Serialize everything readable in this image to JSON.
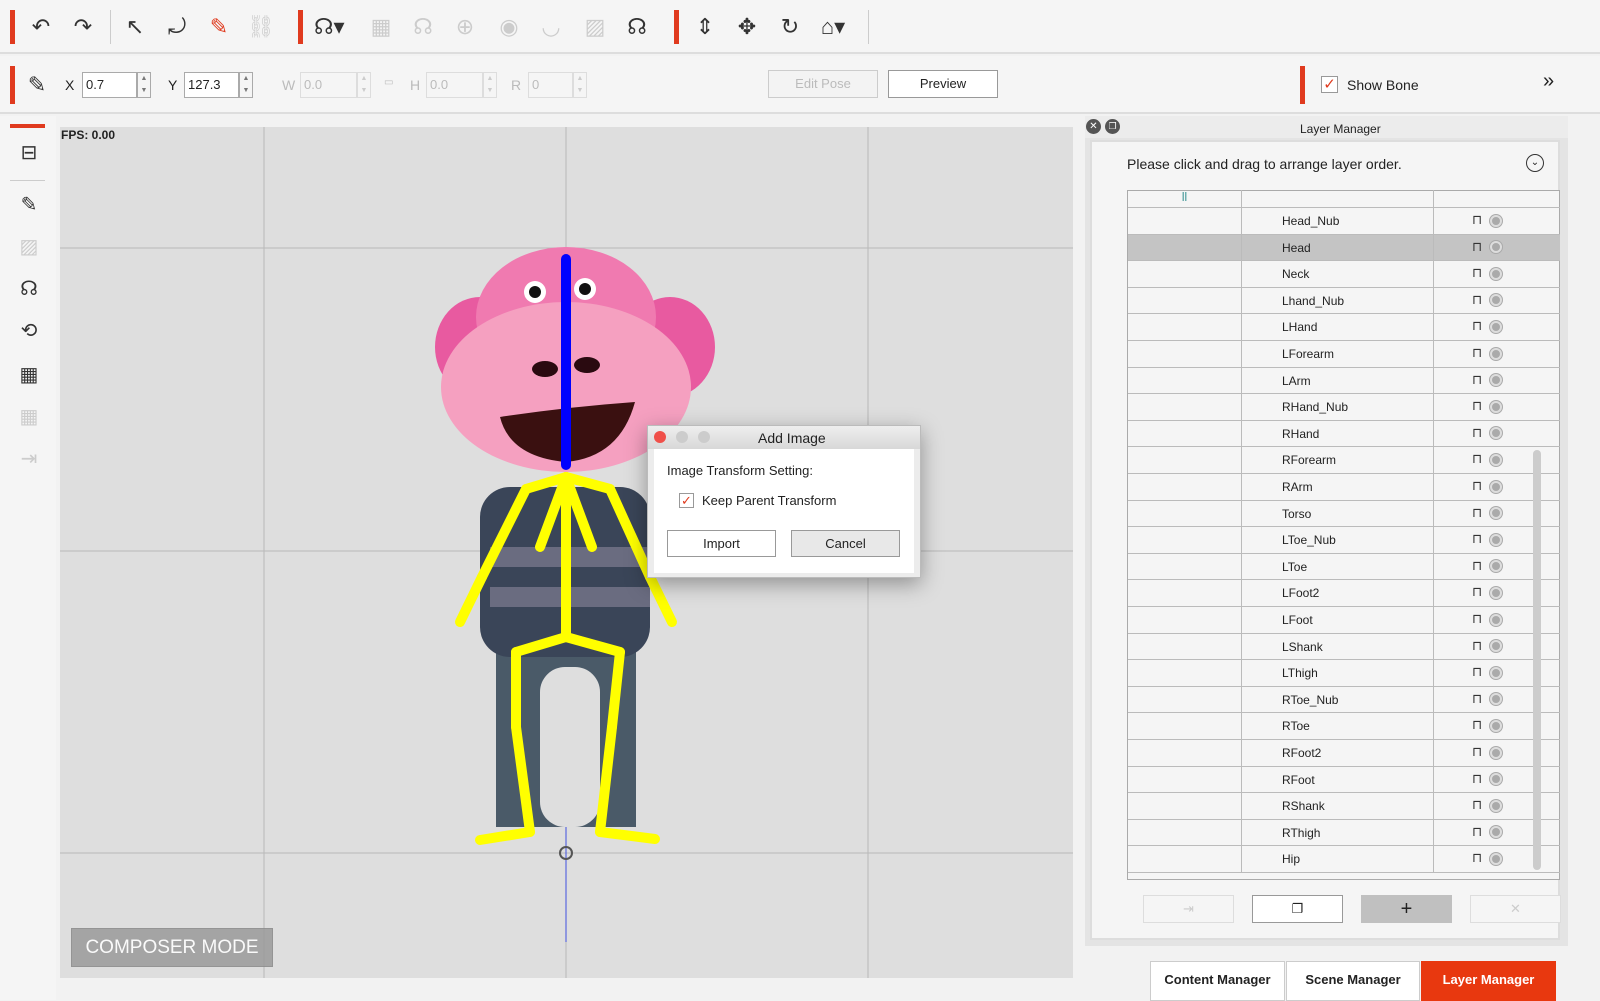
{
  "toolbar": {
    "icons": [
      "undo-icon",
      "redo-icon",
      "select-arrow-icon",
      "rotate-select-icon",
      "bone-edit-icon",
      "link-icon",
      "head-add-icon",
      "grid-icon",
      "head-icon",
      "head-cross-icon",
      "eye-icon",
      "lips-icon",
      "texture-icon",
      "head-remove-icon",
      "move-vertical-icon",
      "move-icon",
      "rotate-icon",
      "home-icon"
    ]
  },
  "transform": {
    "x_label": "X",
    "x_value": "0.7",
    "y_label": "Y",
    "y_value": "127.3",
    "w_label": "W",
    "w_value": "0.0",
    "h_label": "H",
    "h_value": "0.0",
    "r_label": "R",
    "r_value": "0",
    "edit_pose": "Edit Pose",
    "preview": "Preview",
    "show_bone": "Show Bone",
    "show_bone_checked": true
  },
  "canvas": {
    "fps": "FPS: 0.00",
    "mode": "COMPOSER MODE"
  },
  "dialog": {
    "title": "Add Image",
    "setting_label": "Image Transform Setting:",
    "keep_parent": "Keep Parent Transform",
    "keep_parent_checked": true,
    "import": "Import",
    "cancel": "Cancel"
  },
  "layer_manager": {
    "title": "Layer Manager",
    "hint": "Please click and drag to arrange layer order.",
    "selected": "Head",
    "layers": [
      "Head_Nub",
      "Head",
      "Neck",
      "Lhand_Nub",
      "LHand",
      "LForearm",
      "LArm",
      "RHand_Nub",
      "RHand",
      "RForearm",
      "RArm",
      "Torso",
      "LToe_Nub",
      "LToe",
      "LFoot2",
      "LFoot",
      "LShank",
      "LThigh",
      "RToe_Nub",
      "RToe",
      "RFoot2",
      "RFoot",
      "RShank",
      "RThigh",
      "Hip"
    ]
  },
  "tabs": [
    {
      "label": "Content Manager"
    },
    {
      "label": "Scene Manager"
    },
    {
      "label": "Layer Manager",
      "active": true
    }
  ],
  "colors": {
    "accent": "#e03a1e",
    "bone": "#ffff00",
    "selected_bone": "#0000ff"
  }
}
